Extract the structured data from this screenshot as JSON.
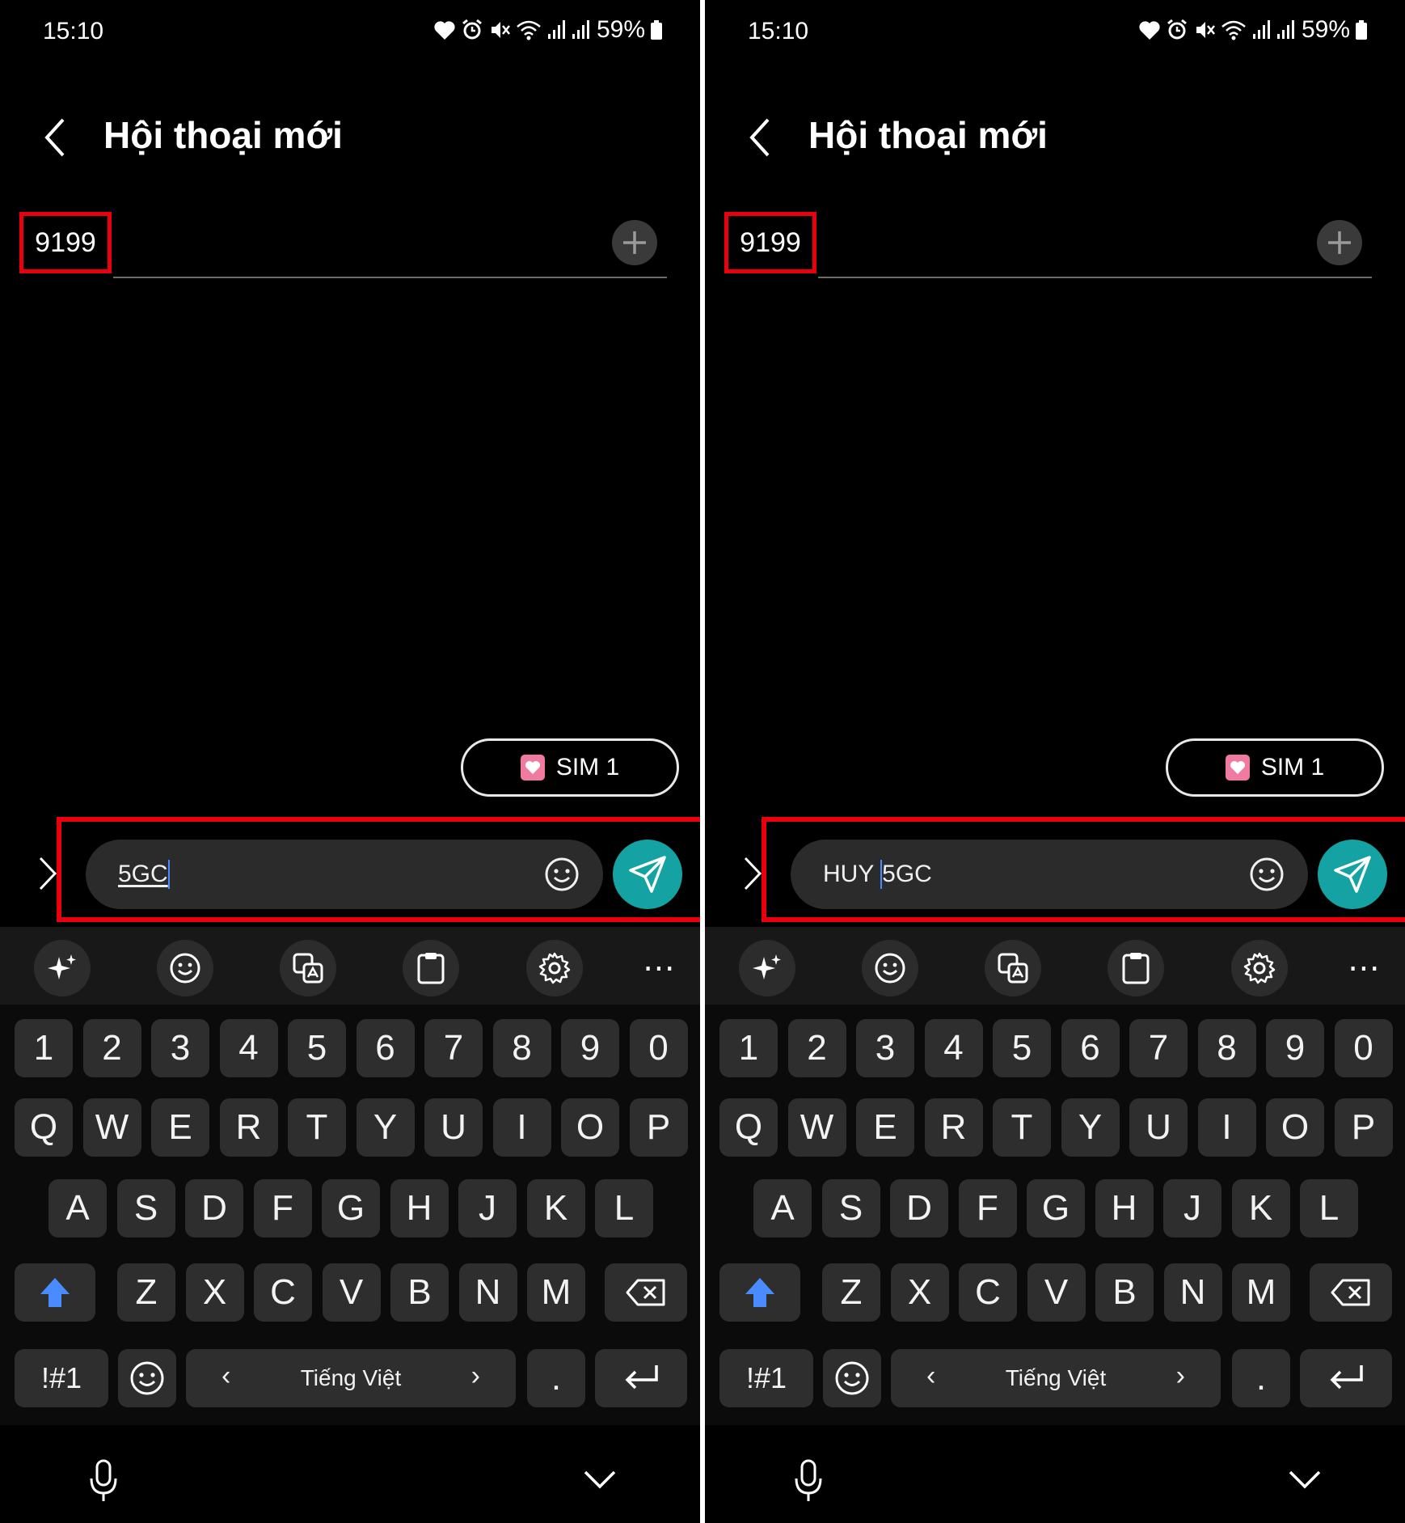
{
  "colors": {
    "highlight_box": "#e8000f",
    "send_button": "#14a3a2",
    "shift_active": "#4a8cff",
    "sim_icon": "#f07aa0"
  },
  "screens": [
    {
      "status": {
        "time": "15:10",
        "battery": "59%",
        "icons": [
          "heart-icon",
          "alarm-icon",
          "mute-icon",
          "wifi-icon",
          "signal-icon",
          "signal-icon",
          "battery-icon"
        ]
      },
      "header": {
        "title": "Hội thoại mới"
      },
      "recipient": {
        "value": "9199"
      },
      "sim": {
        "label": "SIM 1"
      },
      "compose": {
        "prefix": "",
        "text": "5GC",
        "cursor": "end"
      },
      "keyboard": {
        "number_row": [
          "1",
          "2",
          "3",
          "4",
          "5",
          "6",
          "7",
          "8",
          "9",
          "0"
        ],
        "row1": [
          "Q",
          "W",
          "E",
          "R",
          "T",
          "Y",
          "U",
          "I",
          "O",
          "P"
        ],
        "row2": [
          "A",
          "S",
          "D",
          "F",
          "G",
          "H",
          "J",
          "K",
          "L"
        ],
        "row3": [
          "Z",
          "X",
          "C",
          "V",
          "B",
          "N",
          "M"
        ],
        "symbols_key": "!#1",
        "language": "Tiếng Việt",
        "period": "."
      }
    },
    {
      "status": {
        "time": "15:10",
        "battery": "59%",
        "icons": [
          "heart-icon",
          "alarm-icon",
          "mute-icon",
          "wifi-icon",
          "signal-icon",
          "signal-icon",
          "battery-icon"
        ]
      },
      "header": {
        "title": "Hội thoại mới"
      },
      "recipient": {
        "value": "9199"
      },
      "sim": {
        "label": "SIM 1"
      },
      "compose": {
        "prefix": "HUY ",
        "text": "5GC",
        "cursor": "before-text"
      },
      "keyboard": {
        "number_row": [
          "1",
          "2",
          "3",
          "4",
          "5",
          "6",
          "7",
          "8",
          "9",
          "0"
        ],
        "row1": [
          "Q",
          "W",
          "E",
          "R",
          "T",
          "Y",
          "U",
          "I",
          "O",
          "P"
        ],
        "row2": [
          "A",
          "S",
          "D",
          "F",
          "G",
          "H",
          "J",
          "K",
          "L"
        ],
        "row3": [
          "Z",
          "X",
          "C",
          "V",
          "B",
          "N",
          "M"
        ],
        "symbols_key": "!#1",
        "language": "Tiếng Việt",
        "period": "."
      }
    }
  ]
}
